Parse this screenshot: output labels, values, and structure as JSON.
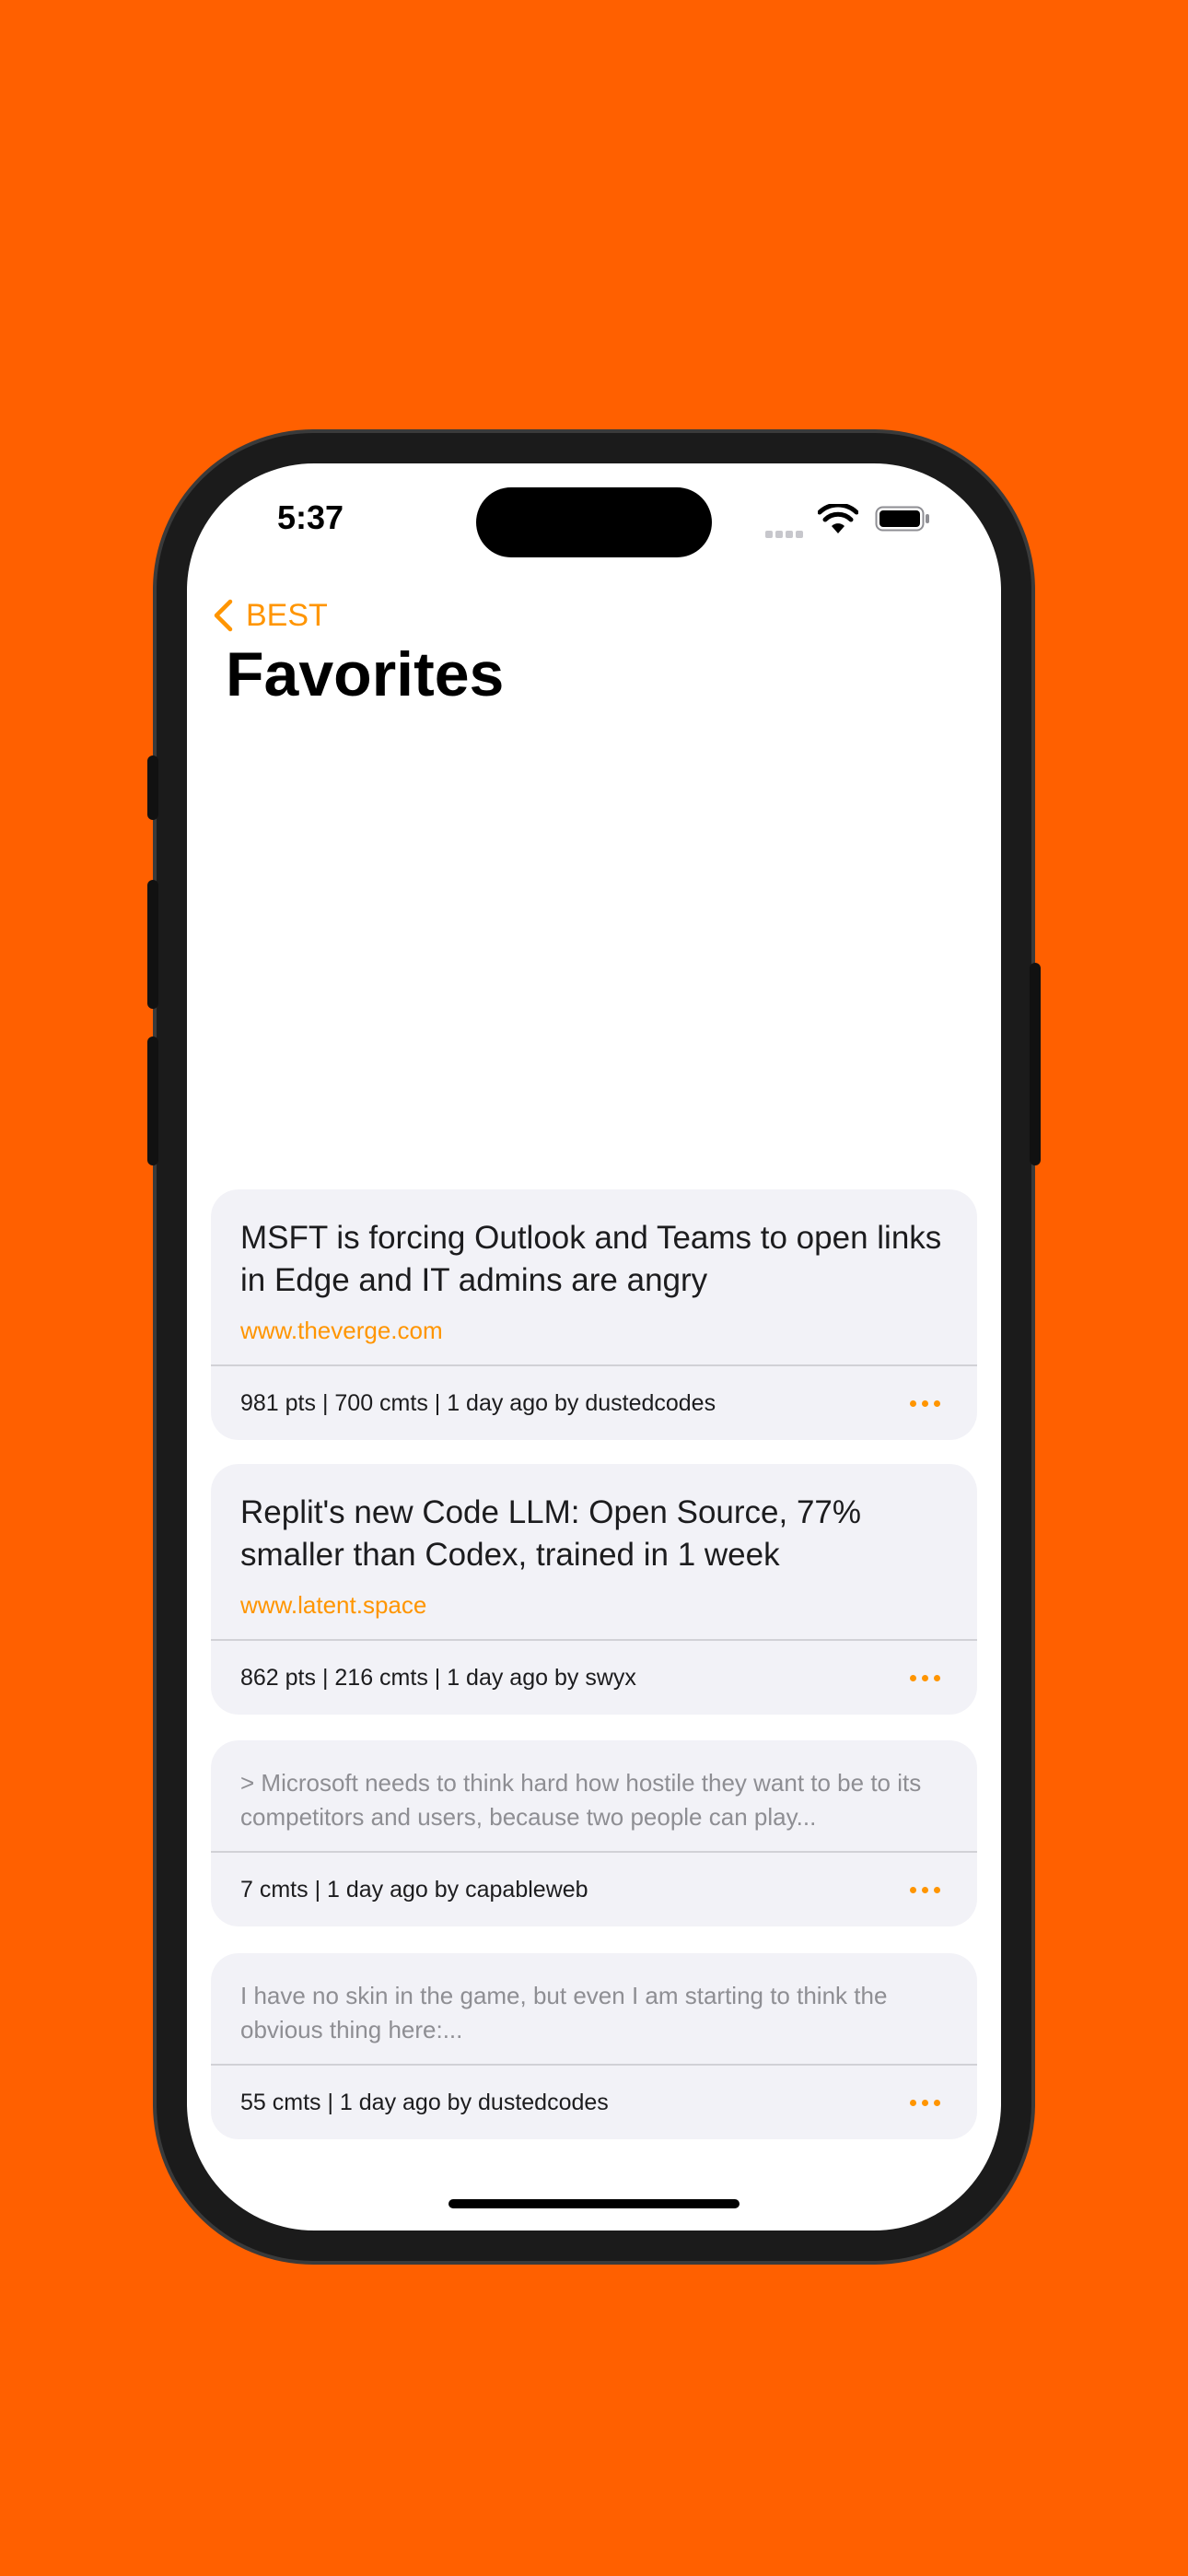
{
  "status_bar": {
    "time": "5:37"
  },
  "nav": {
    "back_label": "BEST"
  },
  "page": {
    "title": "Favorites"
  },
  "stories": [
    {
      "title": "MSFT is forcing Outlook and Teams to open links in Edge and IT admins are angry",
      "domain": "www.theverge.com",
      "meta": "981 pts | 700 cmts | 1 day ago by dustedcodes"
    },
    {
      "title": "Replit's new Code LLM: Open Source, 77% smaller than Codex, trained in 1 week",
      "domain": "www.latent.space",
      "meta": "862 pts | 216 cmts | 1 day ago by swyx"
    }
  ],
  "comments": [
    {
      "snippet": "> Microsoft needs to think hard how hostile they want to be to its competitors and users, because two people can play...",
      "meta": "7 cmts | 1 day ago by capableweb"
    },
    {
      "snippet": "I have no skin in the game, but even I am starting to think the obvious thing here:...",
      "meta": "55 cmts | 1 day ago by dustedcodes"
    }
  ],
  "colors": {
    "background": "#ff6000",
    "accent": "#ff9500",
    "card": "#f2f2f7"
  }
}
